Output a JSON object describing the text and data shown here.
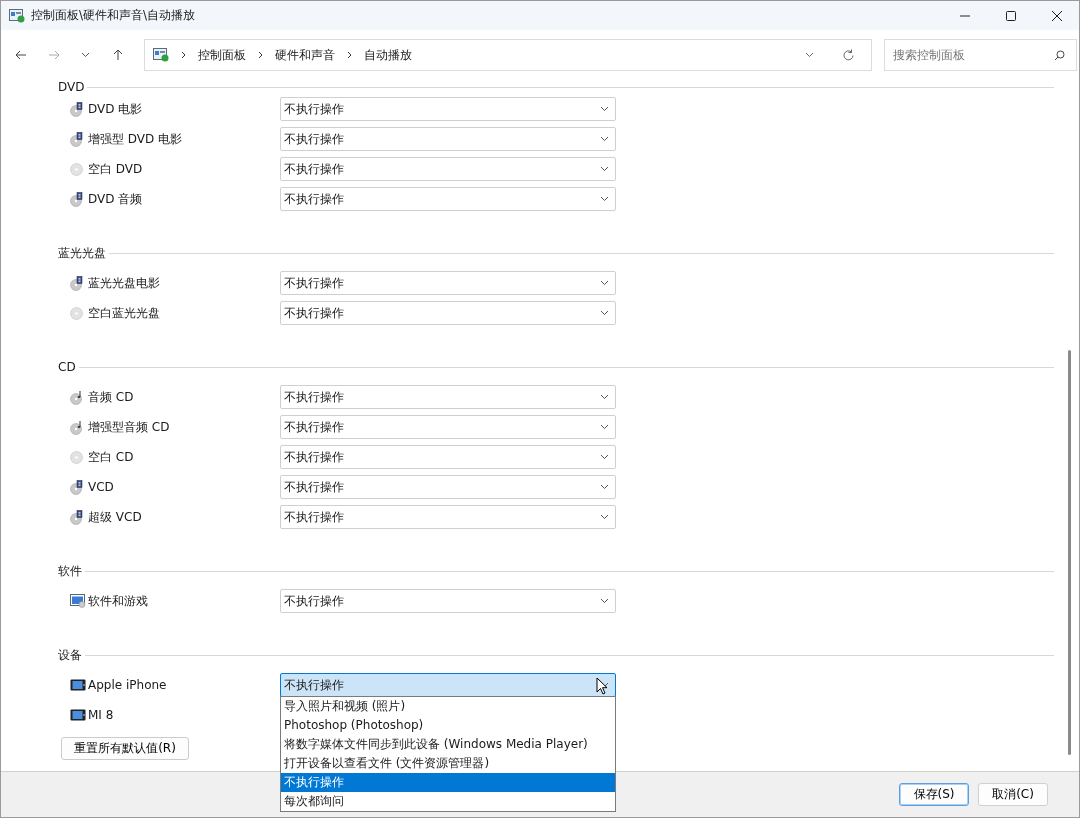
{
  "window": {
    "title": "控制面板\\硬件和声音\\自动播放"
  },
  "address_bar": {
    "breadcrumb": [
      "控制面板",
      "硬件和声音",
      "自动播放"
    ]
  },
  "search": {
    "placeholder": "搜索控制面板"
  },
  "sections": [
    {
      "title": "DVD",
      "items": [
        {
          "kind": "film-disc",
          "label": "DVD 电影",
          "value": "不执行操作"
        },
        {
          "kind": "film-disc",
          "label": "增强型 DVD 电影",
          "value": "不执行操作"
        },
        {
          "kind": "blank-disc",
          "label": "空白 DVD",
          "value": "不执行操作"
        },
        {
          "kind": "film-disc",
          "label": "DVD 音频",
          "value": "不执行操作"
        }
      ]
    },
    {
      "title": "蓝光光盘",
      "items": [
        {
          "kind": "film-disc",
          "label": "蓝光光盘电影",
          "value": "不执行操作"
        },
        {
          "kind": "blank-disc",
          "label": "空白蓝光光盘",
          "value": "不执行操作"
        }
      ]
    },
    {
      "title": "CD",
      "items": [
        {
          "kind": "music-disc",
          "label": "音频 CD",
          "value": "不执行操作"
        },
        {
          "kind": "music-disc",
          "label": "增强型音频 CD",
          "value": "不执行操作"
        },
        {
          "kind": "blank-disc",
          "label": "空白 CD",
          "value": "不执行操作"
        },
        {
          "kind": "film-disc",
          "label": "VCD",
          "value": "不执行操作"
        },
        {
          "kind": "film-disc",
          "label": "超级 VCD",
          "value": "不执行操作"
        }
      ]
    },
    {
      "title": "软件",
      "items": [
        {
          "kind": "software",
          "label": "软件和游戏",
          "value": "不执行操作"
        }
      ]
    },
    {
      "title": "设备",
      "items": [
        {
          "kind": "phone",
          "label": "Apple iPhone",
          "value": "不执行操作",
          "expanded": true,
          "options": [
            {
              "label": "导入照片和视频 (照片)",
              "selected": false
            },
            {
              "label": "Photoshop (Photoshop)",
              "selected": false
            },
            {
              "label": "将数字媒体文件同步到此设备 (Windows Media Player)",
              "selected": false
            },
            {
              "label": "打开设备以查看文件 (文件资源管理器)",
              "selected": false
            },
            {
              "label": "不执行操作",
              "selected": true
            },
            {
              "label": "每次都询问",
              "selected": false
            }
          ]
        },
        {
          "kind": "phone",
          "label": "MI 8"
        }
      ]
    }
  ],
  "reset_button": "重置所有默认值(R)",
  "buttons": [
    {
      "label": "保存(S)",
      "default": true
    },
    {
      "label": "取消(C)",
      "default": false
    }
  ]
}
